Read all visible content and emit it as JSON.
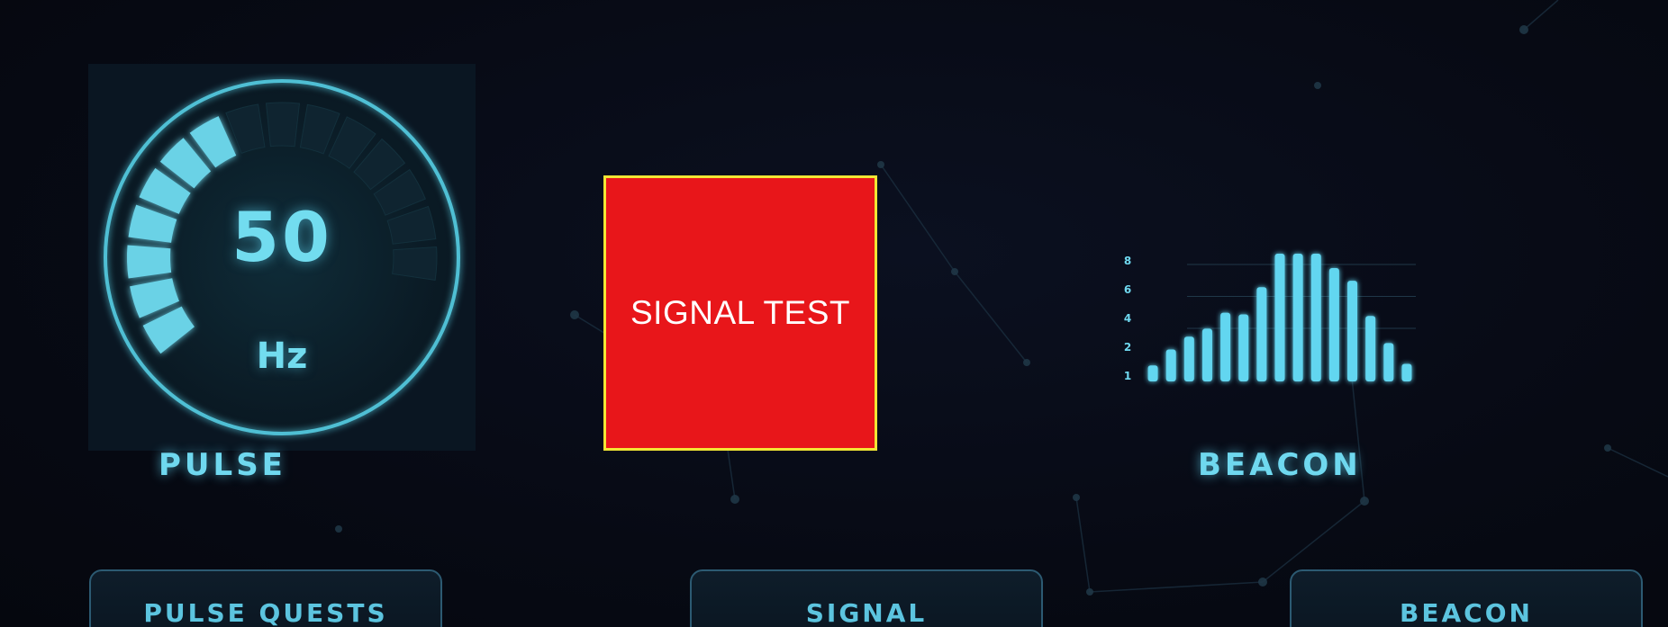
{
  "pulse": {
    "value": "50",
    "unit": "Hz",
    "label": "PULSE",
    "level": 0.35
  },
  "signal": {
    "label": "SIGNAL TEST"
  },
  "beacon": {
    "label": "BEACON",
    "y_ticks": [
      "8",
      "6",
      "4",
      "2",
      "1"
    ],
    "bars": [
      1,
      2,
      2.8,
      3.3,
      4.3,
      4.2,
      5.9,
      8,
      8,
      8,
      7.1,
      6.3,
      4.1,
      2.4,
      1.1
    ]
  },
  "quests": [
    {
      "label": "PULSE QUESTS"
    },
    {
      "label": "SIGNAL"
    },
    {
      "label": "BEACON"
    }
  ],
  "colors": {
    "accent": "#6fd8ef",
    "signal_fill": "#e8161a",
    "signal_border": "#f2e634",
    "card_border": "#2c5a72"
  }
}
